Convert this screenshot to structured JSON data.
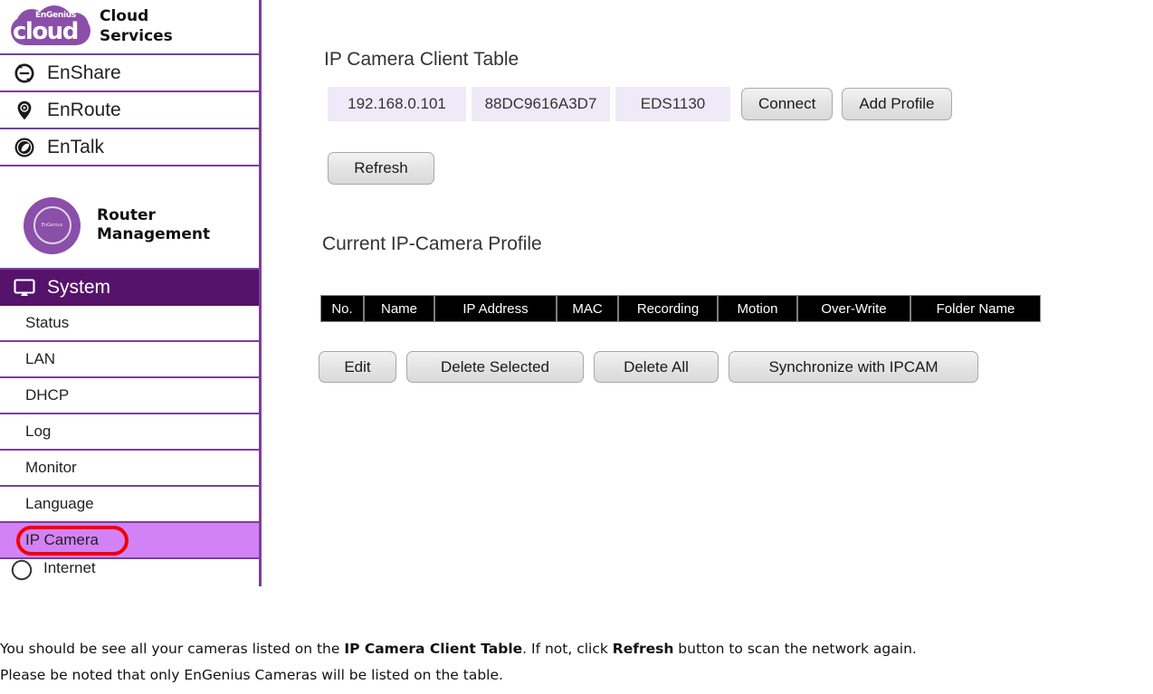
{
  "brand": {
    "logo_badge": "EnGenius",
    "logo_word": "cloud",
    "title_line1": "Cloud",
    "title_line2": "Services"
  },
  "sidebar": {
    "services": [
      {
        "label": "EnShare",
        "icon": "sync-icon"
      },
      {
        "label": "EnRoute",
        "icon": "map-pin-icon"
      },
      {
        "label": "EnTalk",
        "icon": "talk-icon"
      }
    ],
    "router": {
      "badge_text": "EnGenius",
      "title_line1": "Router",
      "title_line2": "Management"
    },
    "section": {
      "label": "System",
      "icon": "monitor-icon"
    },
    "menu": [
      {
        "label": "Status",
        "active": false
      },
      {
        "label": "LAN",
        "active": false
      },
      {
        "label": "DHCP",
        "active": false
      },
      {
        "label": "Log",
        "active": false
      },
      {
        "label": "Monitor",
        "active": false
      },
      {
        "label": "Language",
        "active": false
      },
      {
        "label": "IP Camera",
        "active": true
      }
    ],
    "next_section": {
      "label": "Internet",
      "icon": "globe-icon"
    }
  },
  "main": {
    "client_table": {
      "title": "IP Camera Client Table",
      "row": {
        "ip": "192.168.0.101",
        "mac": "88DC9616A3D7",
        "model": "EDS1130"
      },
      "connect_label": "Connect",
      "add_profile_label": "Add Profile",
      "refresh_label": "Refresh"
    },
    "profile": {
      "title": "Current IP-Camera Profile",
      "columns": [
        "No.",
        "Name",
        "IP Address",
        "MAC",
        "Recording",
        "Motion",
        "Over-Write",
        "Folder Name"
      ],
      "rows": [],
      "buttons": [
        "Edit",
        "Delete Selected",
        "Delete All",
        "Synchronize with IPCAM"
      ]
    }
  },
  "caption": {
    "line1_a": "You should be see all your cameras listed on the ",
    "line1_b": "IP Camera Client Table",
    "line1_c": ". If not, click ",
    "line1_d": "Refresh",
    "line1_e": " button to scan the network again.",
    "line2": "Please be noted that only EnGenius Cameras will be listed on the table."
  },
  "colors": {
    "brand_purple": "#8a4fa8",
    "border_purple": "#7b3fa0",
    "section_purple": "#55136b",
    "active_menu": "#d382f5",
    "cell_lavender": "#eeeaf8",
    "annotation_red": "#f00000",
    "table_header_bg": "#000000"
  }
}
